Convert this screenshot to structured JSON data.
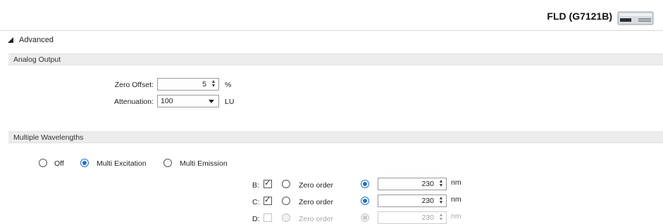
{
  "header": {
    "device_title": "FLD (G7121B)"
  },
  "advanced": {
    "label": "Advanced"
  },
  "analog_output": {
    "section_title": "Analog Output",
    "zero_offset": {
      "label": "Zero Offset:",
      "value": "5",
      "unit": "%"
    },
    "attenuation": {
      "label": "Attenuation:",
      "value": "100",
      "unit": "LU"
    }
  },
  "multiple_wavelengths": {
    "section_title": "Multiple Wavelengths",
    "modes": [
      {
        "label": "Off",
        "selected": false
      },
      {
        "label": "Multi Excitation",
        "selected": true
      },
      {
        "label": "Multi Emission",
        "selected": false
      }
    ],
    "rows": [
      {
        "channel": "B:",
        "checked": true,
        "zero_order_label": "Zero order",
        "value": "230",
        "unit": "nm",
        "enabled": true
      },
      {
        "channel": "C:",
        "checked": true,
        "zero_order_label": "Zero order",
        "value": "230",
        "unit": "nm",
        "enabled": true
      },
      {
        "channel": "D:",
        "checked": false,
        "zero_order_label": "Zero order",
        "value": "230",
        "unit": "nm",
        "enabled": false
      }
    ]
  }
}
